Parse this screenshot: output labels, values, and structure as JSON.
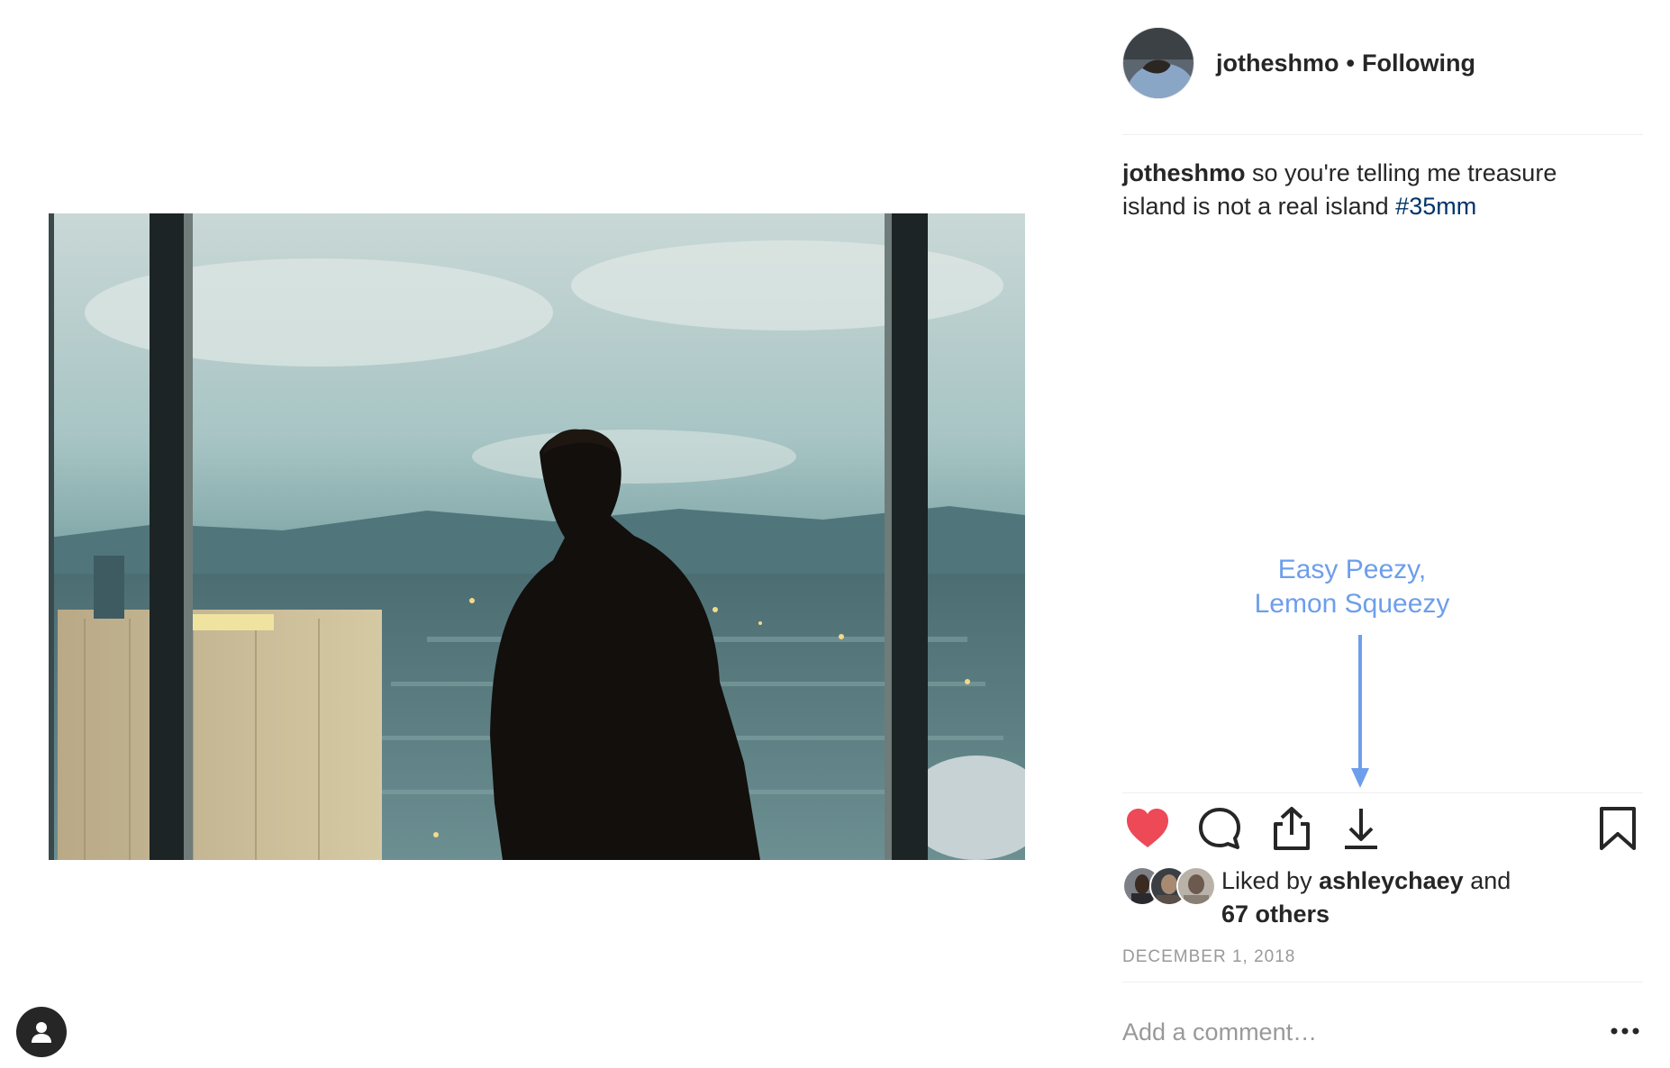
{
  "post": {
    "username": "jotheshmo",
    "separator": "•",
    "follow_status": "Following",
    "caption_user": "jotheshmo",
    "caption_text": " so you're telling me treasure island is not a real island ",
    "caption_tag": "#35mm",
    "likes_prefix": "Liked by ",
    "likes_user": "ashleychaey",
    "likes_mid": " and",
    "likes_others": "67 others",
    "date": "DECEMBER 1, 2018"
  },
  "annotation": {
    "line1": "Easy Peezy,",
    "line2": "Lemon Squeezy"
  },
  "comment": {
    "placeholder": "Add a comment…"
  },
  "actions": {
    "like": "heart-icon",
    "comment": "comment-bubble-icon",
    "share": "share-upload-icon",
    "download": "download-icon",
    "save": "bookmark-icon",
    "more": "more-dots-icon"
  },
  "colors": {
    "like_active": "#ed4956",
    "annotation": "#6d9eeb",
    "hashtag": "#003569",
    "muted": "#999999",
    "text": "#262626"
  }
}
